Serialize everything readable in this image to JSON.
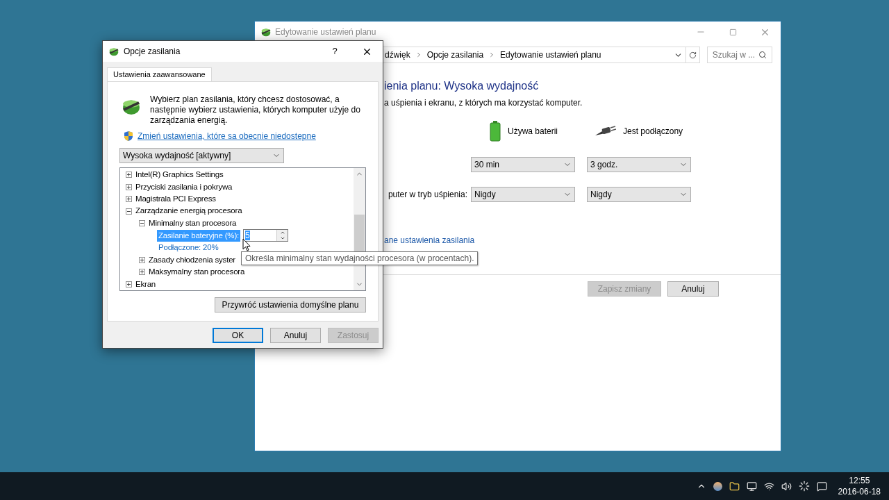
{
  "plan_window": {
    "title": "Edytowanie ustawień planu",
    "breadcrumb": [
      "dźwięk",
      "Opcje zasilania",
      "Edytowanie ustawień planu"
    ],
    "search": {
      "placeholder": "Szukaj w ..."
    },
    "heading": "ienia planu: Wysoka wydajność",
    "subtitle": "a uśpienia i ekranu, z których ma korzystać komputer.",
    "columns": [
      {
        "label": "Używa baterii",
        "kind": "battery"
      },
      {
        "label": "Jest podłączony",
        "kind": "plug"
      }
    ],
    "rows": [
      {
        "label": "",
        "values": [
          "30 min",
          "3 godz."
        ]
      },
      {
        "label": "puter w tryb uśpienia:",
        "values": [
          "Nigdy",
          "Nigdy"
        ]
      }
    ],
    "link": "ane ustawienia zasilania",
    "buttons": [
      {
        "label": "Zapisz zmiany",
        "disabled": true
      },
      {
        "label": "Anuluj",
        "disabled": false
      }
    ]
  },
  "dialog": {
    "title": "Opcje zasilania",
    "help": "?",
    "tab": {
      "label": "Ustawienia zaawansowane",
      "selected": true
    },
    "description": "Wybierz plan zasilania, który chcesz dostosować, a następnie wybierz ustawienia, których komputer użyje do zarządzania energią.",
    "link": "Zmień ustawienia, które sa obecnie niedostepne",
    "plan": "Wysoka wydajność [aktywny]",
    "tree": [
      {
        "kind": "group",
        "label": "Intel(R) Graphics Settings",
        "expanded": false
      },
      {
        "kind": "group",
        "label": "Przyciski zasilania i pokrywa",
        "expanded": false
      },
      {
        "kind": "group",
        "label": "Magistrala PCI Express",
        "expanded": false
      },
      {
        "kind": "group",
        "label": "Zarządzanie energią procesora",
        "expanded": true,
        "children": [
          {
            "kind": "group",
            "label": "Minimalny stan procesora",
            "expanded": true,
            "children": [
              {
                "kind": "setting",
                "label": "Zasilanie bateryjne (%):",
                "selected": true,
                "value": "5"
              },
              {
                "kind": "setting",
                "label": "Podłączone: 20%",
                "selected": false
              }
            ]
          },
          {
            "kind": "group",
            "label": "Zasady chłodzenia syster",
            "expanded": false
          },
          {
            "kind": "group",
            "label": "Maksymalny stan procesora",
            "expanded": false
          }
        ]
      },
      {
        "kind": "group",
        "label": "Ekran",
        "expanded": false
      }
    ],
    "restore": "Przywróć ustawienia domyślne planu",
    "buttons": [
      {
        "label": "OK",
        "disabled": false,
        "default": true
      },
      {
        "label": "Anuluj",
        "disabled": false,
        "default": false
      },
      {
        "label": "Zastosuj",
        "disabled": true,
        "default": false
      }
    ]
  },
  "tooltip": "Określa minimalny stan wydajności procesora (w procentach).",
  "taskbar": {
    "time": "12:55",
    "date": "2016-06-18"
  }
}
